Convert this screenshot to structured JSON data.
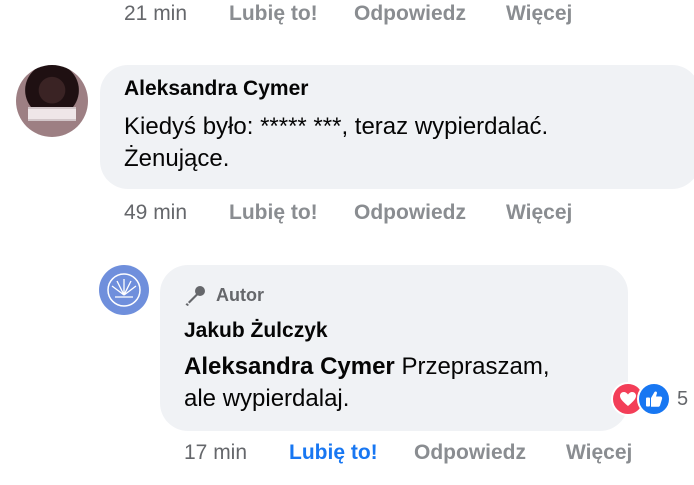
{
  "top_actions": {
    "time": "21 min",
    "like": "Lubię to!",
    "reply": "Odpowiedz",
    "more": "Więcej"
  },
  "comment1": {
    "author": "Aleksandra Cymer",
    "text_line1": "Kiedyś było: ***** ***, teraz wypierdalać.",
    "text_line2": "Żenujące.",
    "actions": {
      "time": "49 min",
      "like": "Lubię to!",
      "reply": "Odpowiedz",
      "more": "Więcej"
    }
  },
  "reply1": {
    "badge": "Autor",
    "author": "Jakub Żulczyk",
    "mention": "Aleksandra Cymer",
    "text_line1_rest": " Przepraszam,",
    "text_line2": "ale wypierdalaj.",
    "reactions_count": "5",
    "actions": {
      "time": "17 min",
      "like": "Lubię to!",
      "reply": "Odpowiedz",
      "more": "Więcej"
    }
  },
  "colors": {
    "bubble": "#f0f2f5",
    "like_active": "#1877f2",
    "heart": "#f33e58",
    "muted": "#8a8d91"
  },
  "icons": [
    "microphone-icon",
    "heart-reaction-icon",
    "like-reaction-icon"
  ]
}
